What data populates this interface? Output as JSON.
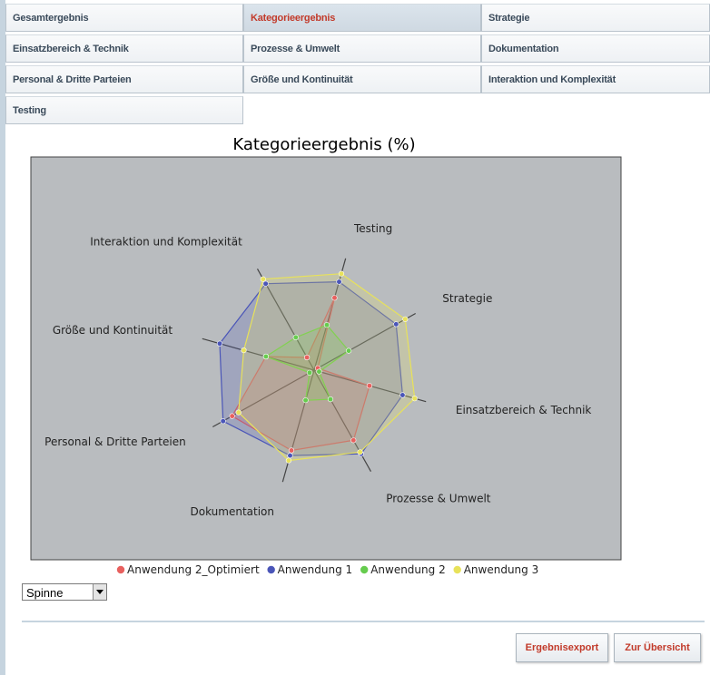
{
  "tabs": [
    {
      "label": "Gesamtergebnis",
      "active": false
    },
    {
      "label": "Kategorieergebnis",
      "active": true
    },
    {
      "label": "Strategie",
      "active": false
    },
    {
      "label": "Einsatzbereich & Technik",
      "active": false
    },
    {
      "label": "Prozesse & Umwelt",
      "active": false
    },
    {
      "label": "Dokumentation",
      "active": false
    },
    {
      "label": "Personal & Dritte Parteien",
      "active": false
    },
    {
      "label": "Größe und Kontinuität",
      "active": false
    },
    {
      "label": "Interaktion und Komplexität",
      "active": false
    },
    {
      "label": "Testing",
      "active": false
    }
  ],
  "chart_type_select": {
    "value": "Spinne"
  },
  "buttons": {
    "export": "Ergebnisexport",
    "overview": "Zur Übersicht"
  },
  "chart_data": {
    "type": "radar",
    "title": "Kategorieergebnis (%)",
    "axes": [
      "Testing",
      "Strategie",
      "Einsatzbereich & Technik",
      "Prozesse & Umwelt",
      "Dokumentation",
      "Personal & Dritte Parteien",
      "Größe und Kontinuität",
      "Interaktion und Komplexität"
    ],
    "range": [
      0,
      100
    ],
    "grid": false,
    "legend_position": "bottom",
    "series": [
      {
        "name": "Anwendung 2_Optimiert",
        "color": "#e8605e",
        "values": [
          72,
          4,
          55,
          77,
          80,
          90,
          48,
          14
        ]
      },
      {
        "name": "Anwendung 1",
        "color": "#4a55b8",
        "values": [
          88,
          90,
          88,
          92,
          85,
          100,
          94,
          95
        ]
      },
      {
        "name": "Anwendung 2",
        "color": "#66cc4e",
        "values": [
          45,
          38,
          5,
          32,
          30,
          5,
          48,
          36
        ]
      },
      {
        "name": "Anwendung 3",
        "color": "#e8e25a",
        "values": [
          96,
          100,
          100,
          90,
          90,
          83,
          70,
          100
        ]
      }
    ]
  }
}
